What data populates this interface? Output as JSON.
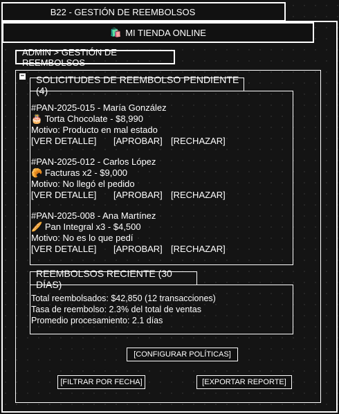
{
  "window": {
    "title": "B22 - GESTIÓN DE REEMBOLSOS"
  },
  "store": {
    "icon": "🛍️",
    "name": "MI TIENDA ONLINE"
  },
  "breadcrumb": "ADMIN > GESTIÓN DE REEMBOLSOS",
  "panel": {
    "collapse_symbol": "−"
  },
  "pending": {
    "title": "SOLICITUDES DE REEMBOLSO PENDIENTE (4)",
    "requests": [
      {
        "header": "#PAN-2025-015 - María González",
        "icon": "🎂",
        "item": "Torta Chocolate - $8,990",
        "reason": "Motivo: Producto en mal estado",
        "view": "[VER DETALLE]",
        "approve": "[APROBAR]",
        "reject": "[RECHAZAR]"
      },
      {
        "header": "#PAN-2025-012 - Carlos López",
        "icon": "🥐",
        "item": "Facturas x2 - $9,000",
        "reason": "Motivo: No llegó el pedido",
        "view": "[VER DETALLE]",
        "approve": "[APROBAR]",
        "reject": "[RECHAZAR]"
      },
      {
        "header": "#PAN-2025-008 - Ana Martínez",
        "icon": "🥖",
        "item": "Pan Integral x3 - $4,500",
        "reason": "Motivo: No es lo que pedí",
        "view": "[VER DETALLE]",
        "approve": "[APROBAR]",
        "reject": "[RECHAZAR]"
      }
    ]
  },
  "recent": {
    "title": "REEMBOLSOS RECIENTE (30 DÍAS)",
    "total": "Total reembolsados: $42,850 (12 transacciones)",
    "rate": "Tasa de reembolso: 2.3% del total de ventas",
    "avg": "Promedio procesamiento: 2.1 días"
  },
  "buttons": {
    "policies": "[CONFIGURAR POLÍTICAS]",
    "filter": "[FILTRAR POR FECHA]",
    "export": "[EXPORTAR REPORTE]"
  }
}
